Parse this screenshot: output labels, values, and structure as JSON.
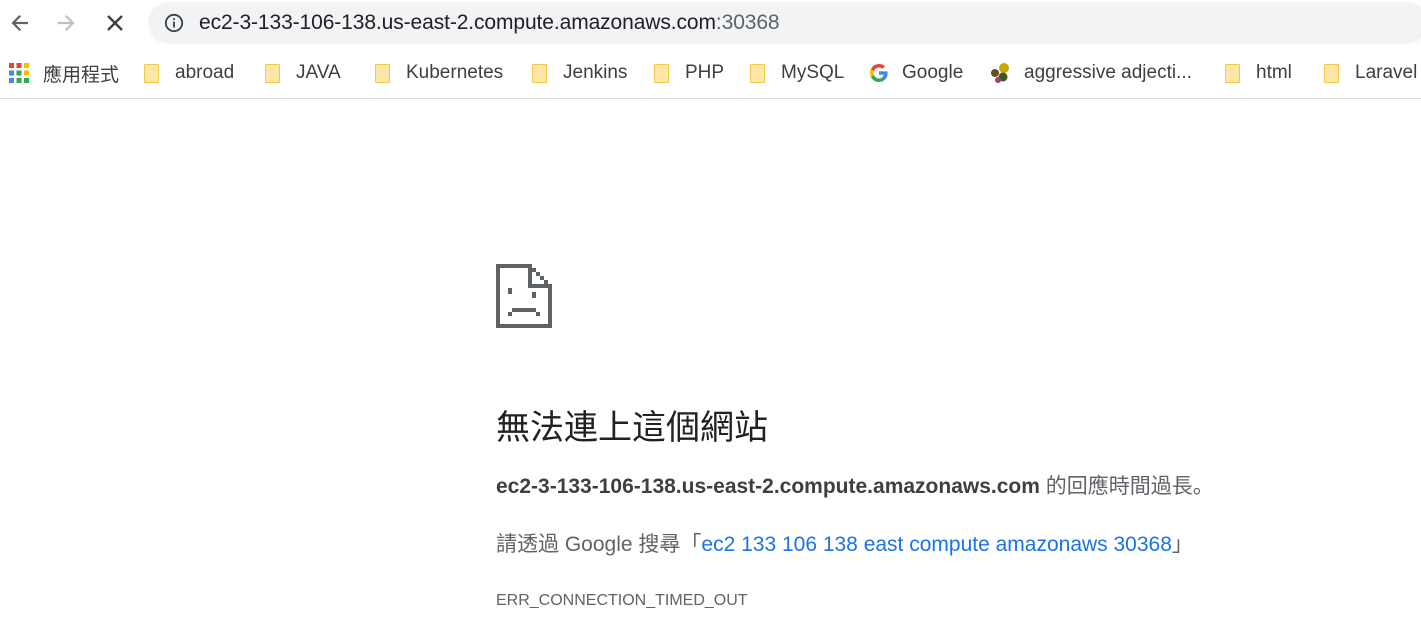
{
  "toolbar": {
    "url_host": "ec2-3-133-106-138.us-east-2.compute.amazonaws.com",
    "url_port": ":30368"
  },
  "bookmarks": [
    {
      "label": "應用程式",
      "icon": "apps-grid-icon"
    },
    {
      "label": "abroad",
      "icon": "folder-icon"
    },
    {
      "label": "JAVA",
      "icon": "folder-icon"
    },
    {
      "label": "Kubernetes",
      "icon": "folder-icon"
    },
    {
      "label": "Jenkins",
      "icon": "folder-icon"
    },
    {
      "label": "PHP",
      "icon": "folder-icon"
    },
    {
      "label": "MySQL",
      "icon": "folder-icon"
    },
    {
      "label": "Google",
      "icon": "google-g-icon"
    },
    {
      "label": "aggressive adjecti...",
      "icon": "site-favicon-icon"
    },
    {
      "label": "html",
      "icon": "folder-icon"
    },
    {
      "label": "Laravel",
      "icon": "folder-icon"
    }
  ],
  "error_page": {
    "icon": "sad-page-icon",
    "heading": "無法連上這個網站",
    "host": "ec2-3-133-106-138.us-east-2.compute.amazonaws.com",
    "host_suffix": " 的回應時間過長。",
    "search_prefix": "請透過 Google 搜尋「",
    "search_link": "ec2 133 106 138 east compute amazonaws 30368",
    "search_suffix": "」",
    "error_code": "ERR_CONNECTION_TIMED_OUT"
  },
  "colors": {
    "omnibox_bg": "#f1f3f4",
    "link": "#1a73e8",
    "folder_fill": "#fce8a4"
  }
}
